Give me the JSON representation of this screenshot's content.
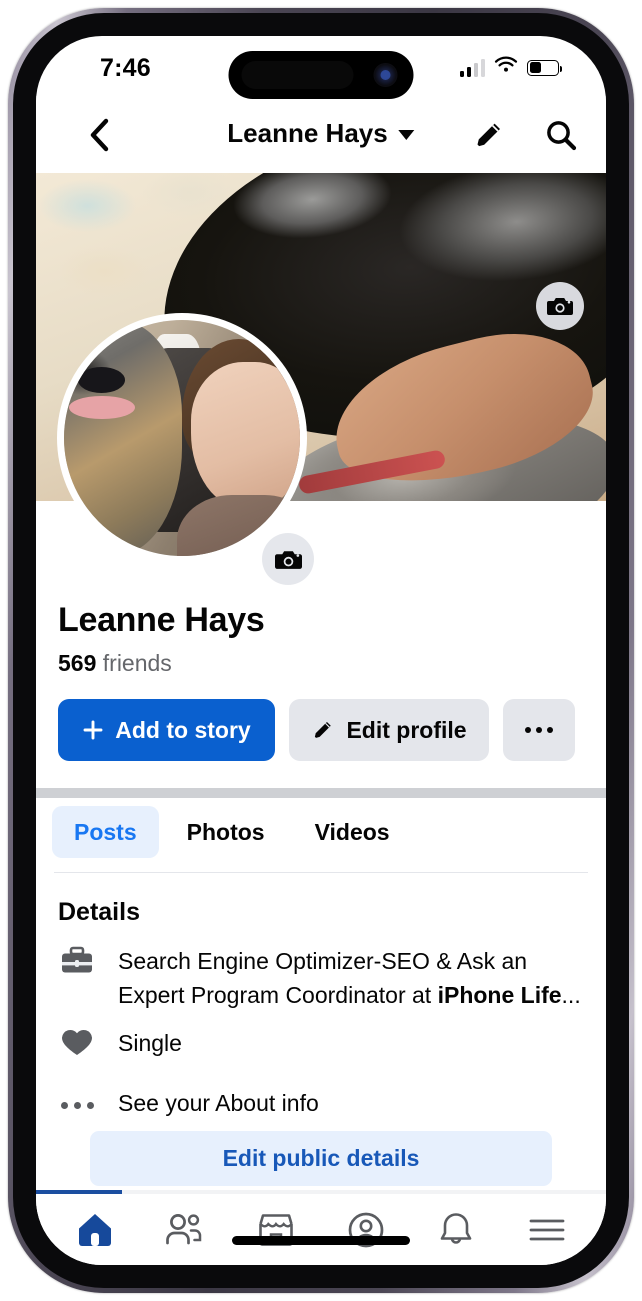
{
  "status_bar": {
    "time": "7:46",
    "cellular_icon": "signal-bars-icon",
    "wifi_icon": "wifi-icon",
    "battery_icon": "battery-icon",
    "battery_level_percent": 42
  },
  "nav_bar": {
    "back_icon": "chevron-left-icon",
    "title": "Leanne Hays",
    "title_caret_icon": "caret-down-icon",
    "edit_icon": "pencil-icon",
    "search_icon": "search-icon",
    "highlight_color": "#fa2e42"
  },
  "cover": {
    "camera_icon": "camera-icon"
  },
  "profile_photo": {
    "camera_icon": "camera-icon"
  },
  "identity": {
    "name": "Leanne Hays",
    "friends_count": "569",
    "friends_label": "friends"
  },
  "actions": {
    "add_story_label": "Add to story",
    "add_story_icon": "plus-icon",
    "add_story_color": "#0a60cf",
    "edit_profile_label": "Edit profile",
    "edit_profile_icon": "pencil-icon",
    "more_icon": "ellipsis-icon"
  },
  "tabs": [
    {
      "label": "Posts",
      "active": true
    },
    {
      "label": "Photos",
      "active": false
    },
    {
      "label": "Videos",
      "active": false
    }
  ],
  "details": {
    "heading": "Details",
    "rows": [
      {
        "icon": "briefcase-icon",
        "text_plain": "Search Engine Optimizer-SEO & Ask an Expert Program Coordinator at ",
        "text_bold": "iPhone Life",
        "text_tail": "..."
      },
      {
        "icon": "heart-icon",
        "text_plain": "Single"
      },
      {
        "icon": "ellipsis-icon",
        "text_plain": "See your About info"
      }
    ],
    "edit_public_label": "Edit public details",
    "edit_public_color": "#1858b8"
  },
  "bottom_nav": [
    {
      "name": "home",
      "icon": "home-icon",
      "active": true
    },
    {
      "name": "friends",
      "icon": "friends-icon",
      "active": false
    },
    {
      "name": "marketplace",
      "icon": "marketplace-icon",
      "active": false
    },
    {
      "name": "profile",
      "icon": "profile-circle-icon",
      "active": false
    },
    {
      "name": "notifications",
      "icon": "bell-icon",
      "active": false
    },
    {
      "name": "menu",
      "icon": "hamburger-menu-icon",
      "active": false
    }
  ]
}
